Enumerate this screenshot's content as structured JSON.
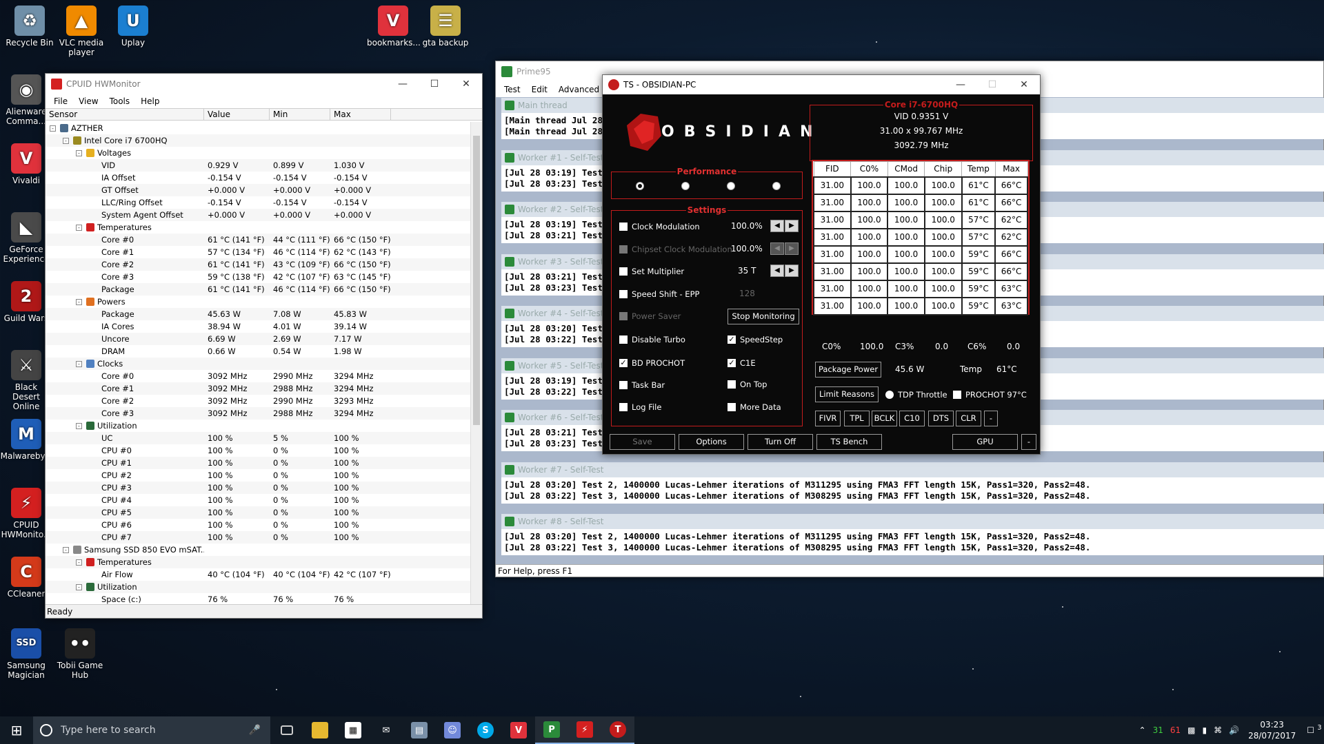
{
  "desktop": {
    "icons": [
      {
        "label": "Recycle Bin",
        "color": "#6f8fa8",
        "glyph": "♻"
      },
      {
        "label": "VLC media player",
        "color": "#f08a00",
        "glyph": "▲"
      },
      {
        "label": "Uplay",
        "color": "#1b7fd1",
        "glyph": "U"
      },
      {
        "label": "bookmarks...",
        "color": "#e0323c",
        "glyph": "V"
      },
      {
        "label": "gta backup",
        "color": "#c8b048",
        "glyph": "☰"
      },
      {
        "label": "Alienware Comma...",
        "color": "#555",
        "glyph": "◉"
      },
      {
        "label": "Vivaldi",
        "color": "#e0323c",
        "glyph": "V"
      },
      {
        "label": "GeForce Experience",
        "color": "#4a4a4a",
        "glyph": "◣"
      },
      {
        "label": "Guild Wars",
        "color": "#b01818",
        "glyph": "2"
      },
      {
        "label": "Black Desert Online",
        "color": "#444",
        "glyph": "⚔"
      },
      {
        "label": "Malwareby...",
        "color": "#1f5eb8",
        "glyph": "M"
      },
      {
        "label": "CPUID HWMonito...",
        "color": "#d42020",
        "glyph": "⚡"
      },
      {
        "label": "CCleaner",
        "color": "#d43a1a",
        "glyph": "C"
      },
      {
        "label": "Samsung Magician",
        "color": "#1a4fa8",
        "glyph": "SSD"
      },
      {
        "label": "Tobii Game Hub",
        "color": "#222",
        "glyph": "••"
      }
    ]
  },
  "hwmonitor": {
    "title": "CPUID HWMonitor",
    "menu": [
      "File",
      "View",
      "Tools",
      "Help"
    ],
    "columns": [
      "Sensor",
      "Value",
      "Min",
      "Max"
    ],
    "status": "Ready",
    "rows": [
      {
        "indent": 0,
        "box": "-",
        "icon": "#4a6a8a",
        "label": "AZTHER",
        "v": "",
        "mn": "",
        "mx": ""
      },
      {
        "indent": 1,
        "box": "-",
        "icon": "#9a8a20",
        "label": "Intel Core i7 6700HQ",
        "v": "",
        "mn": "",
        "mx": ""
      },
      {
        "indent": 2,
        "box": "-",
        "icon": "#e6b020",
        "label": "Voltages",
        "v": "",
        "mn": "",
        "mx": ""
      },
      {
        "indent": 3,
        "label": "VID",
        "v": "0.929 V",
        "mn": "0.899 V",
        "mx": "1.030 V"
      },
      {
        "indent": 3,
        "label": "IA Offset",
        "v": "-0.154 V",
        "mn": "-0.154 V",
        "mx": "-0.154 V"
      },
      {
        "indent": 3,
        "label": "GT Offset",
        "v": "+0.000 V",
        "mn": "+0.000 V",
        "mx": "+0.000 V"
      },
      {
        "indent": 3,
        "label": "LLC/Ring Offset",
        "v": "-0.154 V",
        "mn": "-0.154 V",
        "mx": "-0.154 V"
      },
      {
        "indent": 3,
        "label": "System Agent Offset",
        "v": "+0.000 V",
        "mn": "+0.000 V",
        "mx": "+0.000 V"
      },
      {
        "indent": 2,
        "box": "-",
        "icon": "#d02020",
        "label": "Temperatures",
        "v": "",
        "mn": "",
        "mx": ""
      },
      {
        "indent": 3,
        "label": "Core #0",
        "v": "61 °C (141 °F)",
        "mn": "44 °C (111 °F)",
        "mx": "66 °C (150 °F)"
      },
      {
        "indent": 3,
        "label": "Core #1",
        "v": "57 °C (134 °F)",
        "mn": "46 °C (114 °F)",
        "mx": "62 °C (143 °F)"
      },
      {
        "indent": 3,
        "label": "Core #2",
        "v": "61 °C (141 °F)",
        "mn": "43 °C (109 °F)",
        "mx": "66 °C (150 °F)"
      },
      {
        "indent": 3,
        "label": "Core #3",
        "v": "59 °C (138 °F)",
        "mn": "42 °C (107 °F)",
        "mx": "63 °C (145 °F)"
      },
      {
        "indent": 3,
        "label": "Package",
        "v": "61 °C (141 °F)",
        "mn": "46 °C (114 °F)",
        "mx": "66 °C (150 °F)"
      },
      {
        "indent": 2,
        "box": "-",
        "icon": "#e07020",
        "label": "Powers",
        "v": "",
        "mn": "",
        "mx": ""
      },
      {
        "indent": 3,
        "label": "Package",
        "v": "45.63 W",
        "mn": "7.08 W",
        "mx": "45.83 W"
      },
      {
        "indent": 3,
        "label": "IA Cores",
        "v": "38.94 W",
        "mn": "4.01 W",
        "mx": "39.14 W"
      },
      {
        "indent": 3,
        "label": "Uncore",
        "v": "6.69 W",
        "mn": "2.69 W",
        "mx": "7.17 W"
      },
      {
        "indent": 3,
        "label": "DRAM",
        "v": "0.66 W",
        "mn": "0.54 W",
        "mx": "1.98 W"
      },
      {
        "indent": 2,
        "box": "-",
        "icon": "#5080c0",
        "label": "Clocks",
        "v": "",
        "mn": "",
        "mx": ""
      },
      {
        "indent": 3,
        "label": "Core #0",
        "v": "3092 MHz",
        "mn": "2990 MHz",
        "mx": "3294 MHz"
      },
      {
        "indent": 3,
        "label": "Core #1",
        "v": "3092 MHz",
        "mn": "2988 MHz",
        "mx": "3294 MHz"
      },
      {
        "indent": 3,
        "label": "Core #2",
        "v": "3092 MHz",
        "mn": "2990 MHz",
        "mx": "3293 MHz"
      },
      {
        "indent": 3,
        "label": "Core #3",
        "v": "3092 MHz",
        "mn": "2988 MHz",
        "mx": "3294 MHz"
      },
      {
        "indent": 2,
        "box": "-",
        "icon": "#2a6a3a",
        "label": "Utilization",
        "v": "",
        "mn": "",
        "mx": ""
      },
      {
        "indent": 3,
        "label": "UC",
        "v": "100 %",
        "mn": "5 %",
        "mx": "100 %"
      },
      {
        "indent": 3,
        "label": "CPU #0",
        "v": "100 %",
        "mn": "0 %",
        "mx": "100 %"
      },
      {
        "indent": 3,
        "label": "CPU #1",
        "v": "100 %",
        "mn": "0 %",
        "mx": "100 %"
      },
      {
        "indent": 3,
        "label": "CPU #2",
        "v": "100 %",
        "mn": "0 %",
        "mx": "100 %"
      },
      {
        "indent": 3,
        "label": "CPU #3",
        "v": "100 %",
        "mn": "0 %",
        "mx": "100 %"
      },
      {
        "indent": 3,
        "label": "CPU #4",
        "v": "100 %",
        "mn": "0 %",
        "mx": "100 %"
      },
      {
        "indent": 3,
        "label": "CPU #5",
        "v": "100 %",
        "mn": "0 %",
        "mx": "100 %"
      },
      {
        "indent": 3,
        "label": "CPU #6",
        "v": "100 %",
        "mn": "0 %",
        "mx": "100 %"
      },
      {
        "indent": 3,
        "label": "CPU #7",
        "v": "100 %",
        "mn": "0 %",
        "mx": "100 %"
      },
      {
        "indent": 1,
        "box": "-",
        "icon": "#888",
        "label": "Samsung SSD 850 EVO mSAT...",
        "v": "",
        "mn": "",
        "mx": ""
      },
      {
        "indent": 2,
        "box": "-",
        "icon": "#d02020",
        "label": "Temperatures",
        "v": "",
        "mn": "",
        "mx": ""
      },
      {
        "indent": 3,
        "label": "Air Flow",
        "v": "40 °C (104 °F)",
        "mn": "40 °C (104 °F)",
        "mx": "42 °C (107 °F)"
      },
      {
        "indent": 2,
        "box": "-",
        "icon": "#2a6a3a",
        "label": "Utilization",
        "v": "",
        "mn": "",
        "mx": ""
      },
      {
        "indent": 3,
        "label": "Space (c:)",
        "v": "76 %",
        "mn": "76 %",
        "mx": "76 %"
      }
    ]
  },
  "prime95": {
    "title": "Prime95",
    "menu": [
      "Test",
      "Edit",
      "Advanced",
      "O"
    ],
    "status": "For Help, press F1",
    "workers": [
      {
        "title": "Main thread",
        "l1": "[Main thread Jul 28 03",
        "l2": "[Main thread Jul 28 03"
      },
      {
        "title": "Worker #1 - Self-Test",
        "l1": "[Jul 28 03:19] Test 1,",
        "l2": "[Jul 28 03:23] Test 2,"
      },
      {
        "title": "Worker #2 - Self-Test",
        "l1": "[Jul 28 03:19] Test 1,",
        "l2": "[Jul 28 03:21] Test 2,"
      },
      {
        "title": "Worker #3 - Self-Test",
        "l1": "[Jul 28 03:21] Test 2,",
        "l2": "[Jul 28 03:23] Test 3,"
      },
      {
        "title": "Worker #4 - Self-Test",
        "l1": "[Jul 28 03:20] Test 2,",
        "l2": "[Jul 28 03:22] Test 3,"
      },
      {
        "title": "Worker #5 - Self-Test",
        "l1": "[Jul 28 03:19] Test 1,",
        "l2": "[Jul 28 03:22] Test 2,"
      },
      {
        "title": "Worker #6 - Self-Test",
        "l1": "[Jul 28 03:21] Test 2,",
        "l2": "[Jul 28 03:23] Test 3,"
      },
      {
        "title": "Worker #7 - Self-Test",
        "l1": "[Jul 28 03:20] Test 2, 1400000 Lucas-Lehmer iterations of M311295 using FMA3 FFT length 15K, Pass1=320, Pass2=48.",
        "l2": "[Jul 28 03:22] Test 3, 1400000 Lucas-Lehmer iterations of M308295 using FMA3 FFT length 15K, Pass1=320, Pass2=48."
      },
      {
        "title": "Worker #8 - Self-Test",
        "l1": "[Jul 28 03:20] Test 2, 1400000 Lucas-Lehmer iterations of M311295 using FMA3 FFT length 15K, Pass1=320, Pass2=48.",
        "l2": "[Jul 28 03:22] Test 3, 1400000 Lucas-Lehmer iterations of M308295 using FMA3 FFT length 15K, Pass1=320, Pass2=48."
      }
    ]
  },
  "throttlestop": {
    "title": "TS - OBSIDIAN-PC",
    "logo": "OBSIDIAN",
    "cpu_title": "Core i7-6700HQ",
    "vid": "VID  0.9351 V",
    "multiplier": "31.00 x 99.767 MHz",
    "freq": "3092.79 MHz",
    "performance_label": "Performance",
    "settings_label": "Settings",
    "settings": {
      "clock_mod": "Clock Modulation",
      "clock_mod_val": "100.0%",
      "chipset_mod": "Chipset Clock Modulation",
      "chipset_mod_val": "100.0%",
      "set_mult": "Set Multiplier",
      "set_mult_val": "35 T",
      "speed_shift": "Speed Shift - EPP",
      "speed_shift_val": "128",
      "power_saver": "Power Saver",
      "stop_monitoring": "Stop Monitoring",
      "disable_turbo": "Disable Turbo",
      "speedstep": "SpeedStep",
      "bd_prochot": "BD PROCHOT",
      "c1e": "C1E",
      "task_bar": "Task Bar",
      "on_top": "On Top",
      "log_file": "Log File",
      "more_data": "More Data"
    },
    "table_headers": [
      "FID",
      "C0%",
      "CMod",
      "Chip",
      "Temp",
      "Max"
    ],
    "table_rows": [
      [
        "31.00",
        "100.0",
        "100.0",
        "100.0",
        "61°C",
        "66°C"
      ],
      [
        "31.00",
        "100.0",
        "100.0",
        "100.0",
        "61°C",
        "66°C"
      ],
      [
        "31.00",
        "100.0",
        "100.0",
        "100.0",
        "57°C",
        "62°C"
      ],
      [
        "31.00",
        "100.0",
        "100.0",
        "100.0",
        "57°C",
        "62°C"
      ],
      [
        "31.00",
        "100.0",
        "100.0",
        "100.0",
        "59°C",
        "66°C"
      ],
      [
        "31.00",
        "100.0",
        "100.0",
        "100.0",
        "59°C",
        "66°C"
      ],
      [
        "31.00",
        "100.0",
        "100.0",
        "100.0",
        "59°C",
        "63°C"
      ],
      [
        "31.00",
        "100.0",
        "100.0",
        "100.0",
        "59°C",
        "63°C"
      ]
    ],
    "summary": {
      "c0_label": "C0%",
      "c0_val": "100.0",
      "c3_label": "C3%",
      "c3_val": "0.0",
      "c6_label": "C6%",
      "c6_val": "0.0"
    },
    "package_power_btn": "Package Power",
    "package_power_val": "45.6 W",
    "temp_label": "Temp",
    "temp_val": "61°C",
    "limit_reasons_btn": "Limit Reasons",
    "tdp_throttle": "TDP Throttle",
    "prochot": "PROCHOT 97°C",
    "small_buttons": [
      "FIVR",
      "TPL",
      "BCLK",
      "C10",
      "DTS",
      "CLR",
      "-"
    ],
    "bottom_buttons": {
      "save": "Save",
      "options": "Options",
      "turn_off": "Turn Off",
      "ts_bench": "TS Bench",
      "gpu": "GPU",
      "minus": "-"
    }
  },
  "taskbar": {
    "search_placeholder": "Type here to search",
    "tray_temp1": "31",
    "tray_temp2": "61",
    "time": "03:23",
    "date": "28/07/2017",
    "notif_count": "3"
  }
}
